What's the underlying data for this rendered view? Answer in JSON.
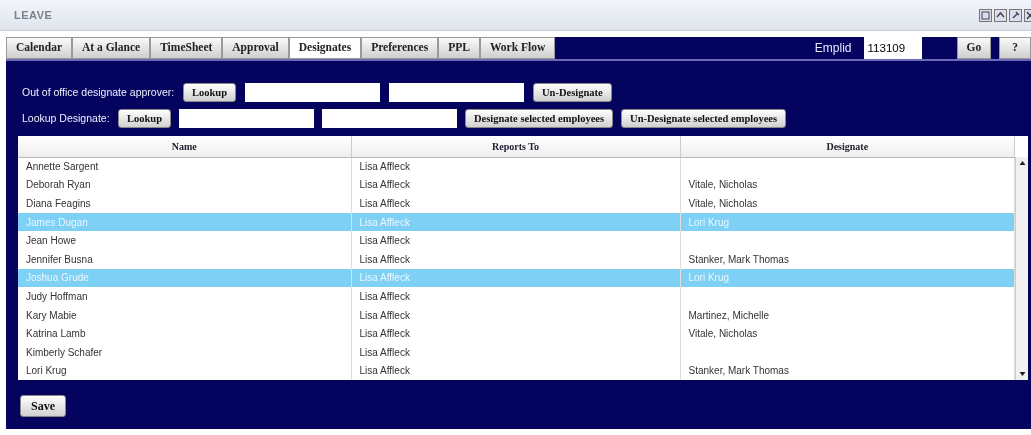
{
  "window": {
    "title": "LEAVE"
  },
  "tabs": [
    {
      "label": "Calendar",
      "selected": false
    },
    {
      "label": "At a Glance",
      "selected": false
    },
    {
      "label": "TimeSheet",
      "selected": false
    },
    {
      "label": "Approval",
      "selected": false
    },
    {
      "label": "Designates",
      "selected": true
    },
    {
      "label": "Preferences",
      "selected": false
    },
    {
      "label": "PPL",
      "selected": false
    },
    {
      "label": "Work Flow",
      "selected": false
    }
  ],
  "emplid": {
    "label": "Emplid",
    "value": "113109",
    "go_button": "Go",
    "help_button": "?"
  },
  "out_of_office": {
    "label": "Out of office designate approver:",
    "lookup_button": "Lookup",
    "undesignate_button": "Un-Designate"
  },
  "lookup_designate": {
    "label": "Lookup Designate:",
    "lookup_button": "Lookup",
    "designate_button": "Designate selected employees",
    "undesignate_button": "Un-Designate selected employees"
  },
  "table": {
    "columns": [
      "Name",
      "Reports To",
      "Designate"
    ],
    "rows": [
      {
        "name": "Annette Sargent",
        "reports_to": "Lisa Affleck",
        "designate": "",
        "selected": false
      },
      {
        "name": "Deborah Ryan",
        "reports_to": "Lisa Affleck",
        "designate": "Vitale, Nicholas",
        "selected": false
      },
      {
        "name": "Diana Feagins",
        "reports_to": "Lisa Affleck",
        "designate": "Vitale, Nicholas",
        "selected": false
      },
      {
        "name": "James Dugan",
        "reports_to": "Lisa Affleck",
        "designate": "Lori Krug",
        "selected": true
      },
      {
        "name": "Jean Howe",
        "reports_to": "Lisa Affleck",
        "designate": "",
        "selected": false
      },
      {
        "name": "Jennifer Busna",
        "reports_to": "Lisa Affleck",
        "designate": "Stanker, Mark Thomas",
        "selected": false
      },
      {
        "name": "Joshua Grude",
        "reports_to": "Lisa Affleck",
        "designate": "Lori Krug",
        "selected": true
      },
      {
        "name": "Judy Hoffman",
        "reports_to": "Lisa Affleck",
        "designate": "",
        "selected": false
      },
      {
        "name": "Kary Mabie",
        "reports_to": "Lisa Affleck",
        "designate": "Martinez, Michelle",
        "selected": false
      },
      {
        "name": "Katrina Lamb",
        "reports_to": "Lisa Affleck",
        "designate": "Vitale, Nicholas",
        "selected": false
      },
      {
        "name": "Kimberly Schafer",
        "reports_to": "Lisa Affleck",
        "designate": "",
        "selected": false
      },
      {
        "name": "Lori Krug",
        "reports_to": "Lisa Affleck",
        "designate": "Stanker, Mark Thomas",
        "selected": false
      }
    ]
  },
  "save_button": "Save"
}
